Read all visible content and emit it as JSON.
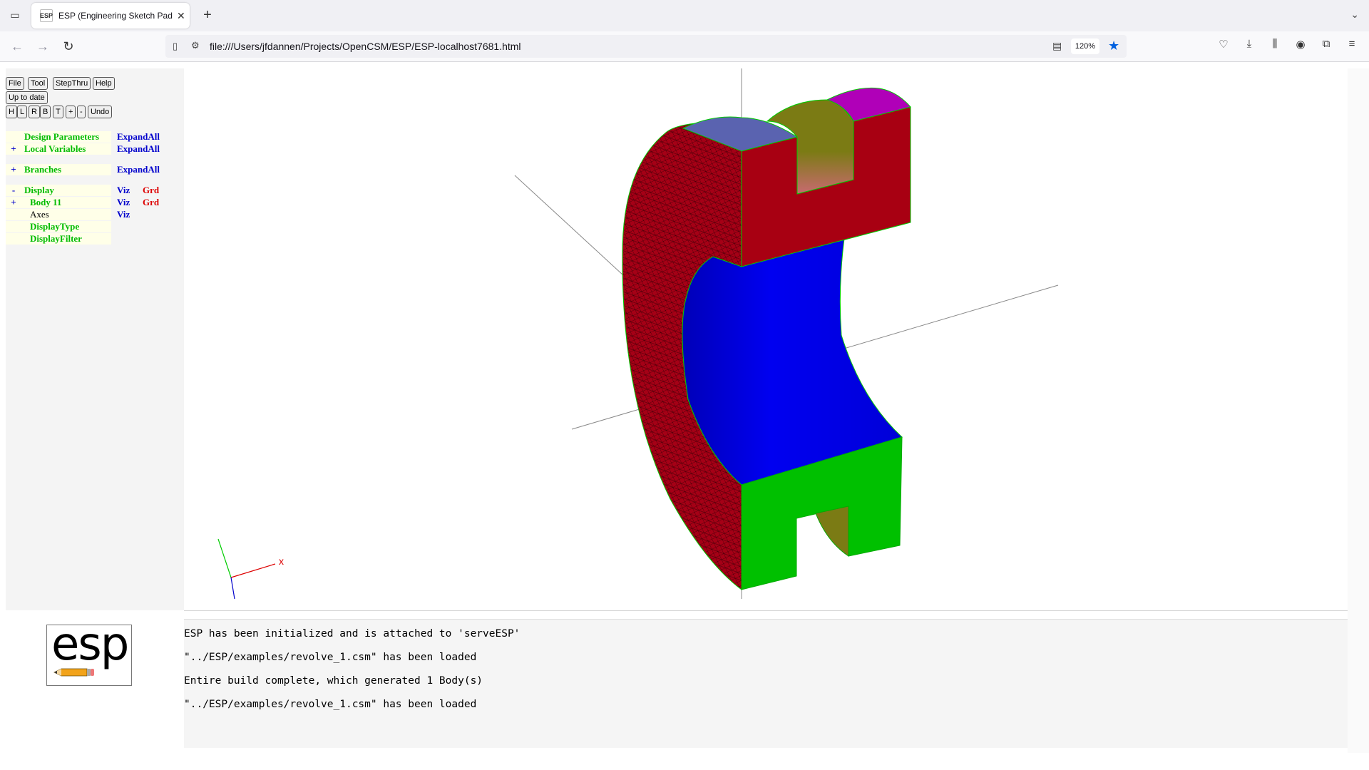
{
  "browser": {
    "tab_title": "ESP (Engineering Sketch Pad, V",
    "favicon_text": "ESP",
    "url": "file:///Users/jfdannen/Projects/OpenCSM/ESP/ESP-localhost7681.html",
    "zoom": "120%",
    "icons": {
      "tab_list": "tab-list-icon",
      "close": "close-icon",
      "new_tab": "plus-icon",
      "back": "back-arrow-icon",
      "forward": "forward-arrow-icon",
      "reload": "reload-icon",
      "page": "page-icon",
      "permissions": "permissions-icon",
      "reader": "reader-view-icon",
      "bookmark": "star-icon",
      "pocket": "pocket-icon",
      "downloads": "download-icon",
      "library": "library-icon",
      "account": "account-icon",
      "extensions": "extensions-icon",
      "menu": "hamburger-menu-icon"
    }
  },
  "toolbar": {
    "file": "File",
    "tool": "Tool",
    "stepthru": "StepThru",
    "help": "Help",
    "status": "Up to date",
    "view_buttons": [
      "H",
      "L",
      "R",
      "B",
      "T",
      "+",
      "-"
    ],
    "undo": "Undo"
  },
  "tree": {
    "design_parameters": {
      "label": "Design Parameters",
      "action": "ExpandAll"
    },
    "local_variables": {
      "toggle": "+",
      "label": "Local Variables",
      "action": "ExpandAll"
    },
    "branches": {
      "toggle": "+",
      "label": "Branches",
      "action": "ExpandAll"
    },
    "display": {
      "toggle": "-",
      "label": "Display",
      "viz": "Viz",
      "grd": "Grd"
    },
    "body": {
      "toggle": "+",
      "label": "Body 11",
      "viz": "Viz",
      "grd": "Grd"
    },
    "axes": {
      "label": "Axes",
      "viz": "Viz"
    },
    "display_type": {
      "label": "DisplayType"
    },
    "display_filter": {
      "label": "DisplayFilter"
    }
  },
  "messages": [
    "ESP has been initialized and is attached to 'serveESP'",
    "\"../ESP/examples/revolve_1.csm\" has been loaded",
    "Entire build complete, which generated 1 Body(s)",
    "\"../ESP/examples/revolve_1.csm\" has been loaded"
  ],
  "logo": {
    "text": "esp"
  },
  "colors": {
    "tree_green": "#00bb00",
    "tree_blue": "#0000cc",
    "tree_red": "#dd0000",
    "face_red": "#a80012",
    "face_blue": "#0000e0",
    "face_green": "#00c000",
    "face_olive": "#7b7b14",
    "face_magenta": "#b000b8",
    "face_slate": "#5a63b0"
  }
}
